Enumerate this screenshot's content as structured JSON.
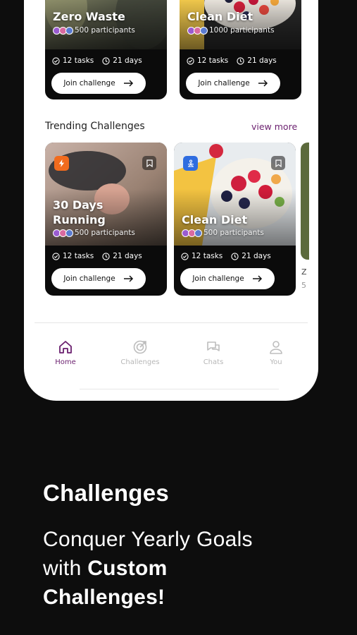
{
  "top_cards": [
    {
      "title": "Zero Waste",
      "participants": "500 participants",
      "tasks": "12 tasks",
      "days": "21 days",
      "cta": "Join challenge"
    },
    {
      "title": "Clean Diet",
      "participants": "1000 participants",
      "tasks": "12 tasks",
      "days": "21 days",
      "cta": "Join challenge"
    }
  ],
  "trending": {
    "title": "Trending Challenges",
    "view_more": "view more",
    "cards": [
      {
        "title_line1": "30 Days",
        "title_line2": "Running",
        "participants": "500 participants",
        "tasks": "12 tasks",
        "days": "21 days",
        "cta": "Join challenge",
        "badge_icon": "lightning-icon",
        "badge_color": "#f26b1d"
      },
      {
        "title_line1": "Clean Diet",
        "participants": "500 participants",
        "tasks": "12 tasks",
        "days": "21 days",
        "cta": "Join challenge",
        "badge_icon": "meditation-icon",
        "badge_color": "#2f6de0"
      }
    ],
    "peek_letter": "Z",
    "peek_digit": "5"
  },
  "tabs": [
    {
      "label": "Home",
      "icon": "home-icon",
      "active": true
    },
    {
      "label": "Challenges",
      "icon": "target-icon",
      "active": false
    },
    {
      "label": "Chats",
      "icon": "chat-icon",
      "active": false
    },
    {
      "label": "You",
      "icon": "user-icon",
      "active": false
    }
  ],
  "promo": {
    "headline": "Challenges",
    "tagline_line1": "Conquer Yearly Goals",
    "tagline_line2_plain": "with ",
    "tagline_line2_bold": "Custom",
    "tagline_line3_bold": "Challenges!"
  },
  "colors": {
    "accent": "#6a1f6e",
    "card_bg": "#0b0b0b",
    "page_bg": "#0d0d0d"
  }
}
